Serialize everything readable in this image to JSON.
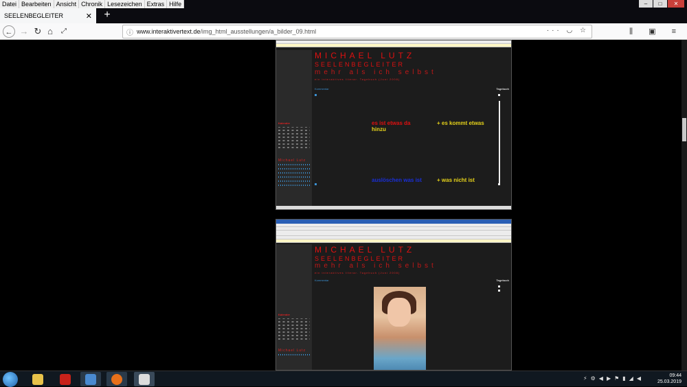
{
  "menubar": {
    "items": [
      "Datei",
      "Bearbeiten",
      "Ansicht",
      "Chronik",
      "Lesezeichen",
      "Extras",
      "Hilfe"
    ]
  },
  "tab": {
    "title": "SEELENBEGLEITER"
  },
  "urlbar": {
    "domain": "www.interaktivertext.de",
    "path": "/img_html_ausstellungen/a_bilder_09.html"
  },
  "site": {
    "title": "MICHAEL LUTZ",
    "subtitle": "SEELENBEGLEITER",
    "tagline": "mehr als ich selbst",
    "small": "ein interaktives literar. Tagebuch (Juni 2008)",
    "kalender_label": "Kalender",
    "author_label": "Michael Lutz",
    "tagebuch_label": "Tagebuch",
    "kommentar": "Kommentar"
  },
  "poem": {
    "line1_red": "es ist etwas da",
    "line1_yellow": "hinzu",
    "line2_yellow": "+ es kommt etwas",
    "line3_blue": "auslöschen was ist",
    "line4_yellow": "+ was nicht ist"
  },
  "taskbar": {
    "time": "09:44",
    "date": "25.03.2019"
  },
  "colors": {
    "accent_red": "#e01010",
    "yellow": "#e6d21a",
    "blue": "#1a2fd8",
    "link_blue": "#3a8fd0"
  }
}
